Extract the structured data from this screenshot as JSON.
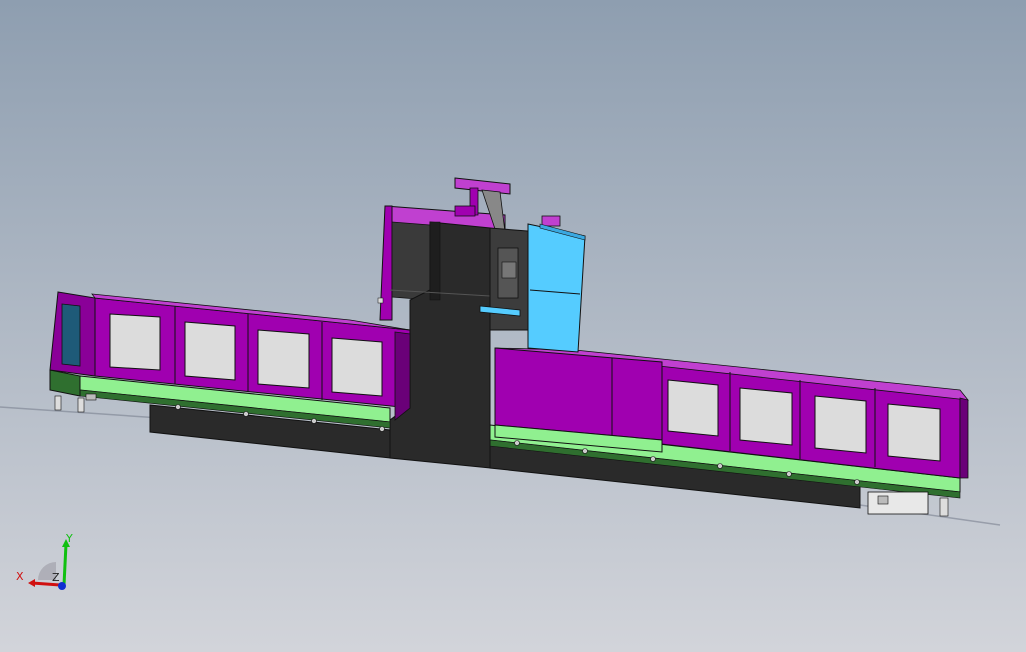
{
  "viewport": {
    "background_top": "#8e9eb0",
    "background_bottom": "#d2d4da"
  },
  "model": {
    "colors": {
      "magenta": "#a000b0",
      "magenta_dark": "#6a0078",
      "magenta_light": "#c040d0",
      "panel_gray": "#dcdcdc",
      "green": "#90f090",
      "green_dark": "#2f6f2f",
      "column_dark": "#2a2a2a",
      "cyan": "#55ccff",
      "outline": "#111111"
    }
  },
  "triad": {
    "x_label": "X",
    "y_label": "Y",
    "z_label": "Z",
    "x_color": "#d01010",
    "y_color": "#10c010",
    "z_color": "#1030d0"
  }
}
